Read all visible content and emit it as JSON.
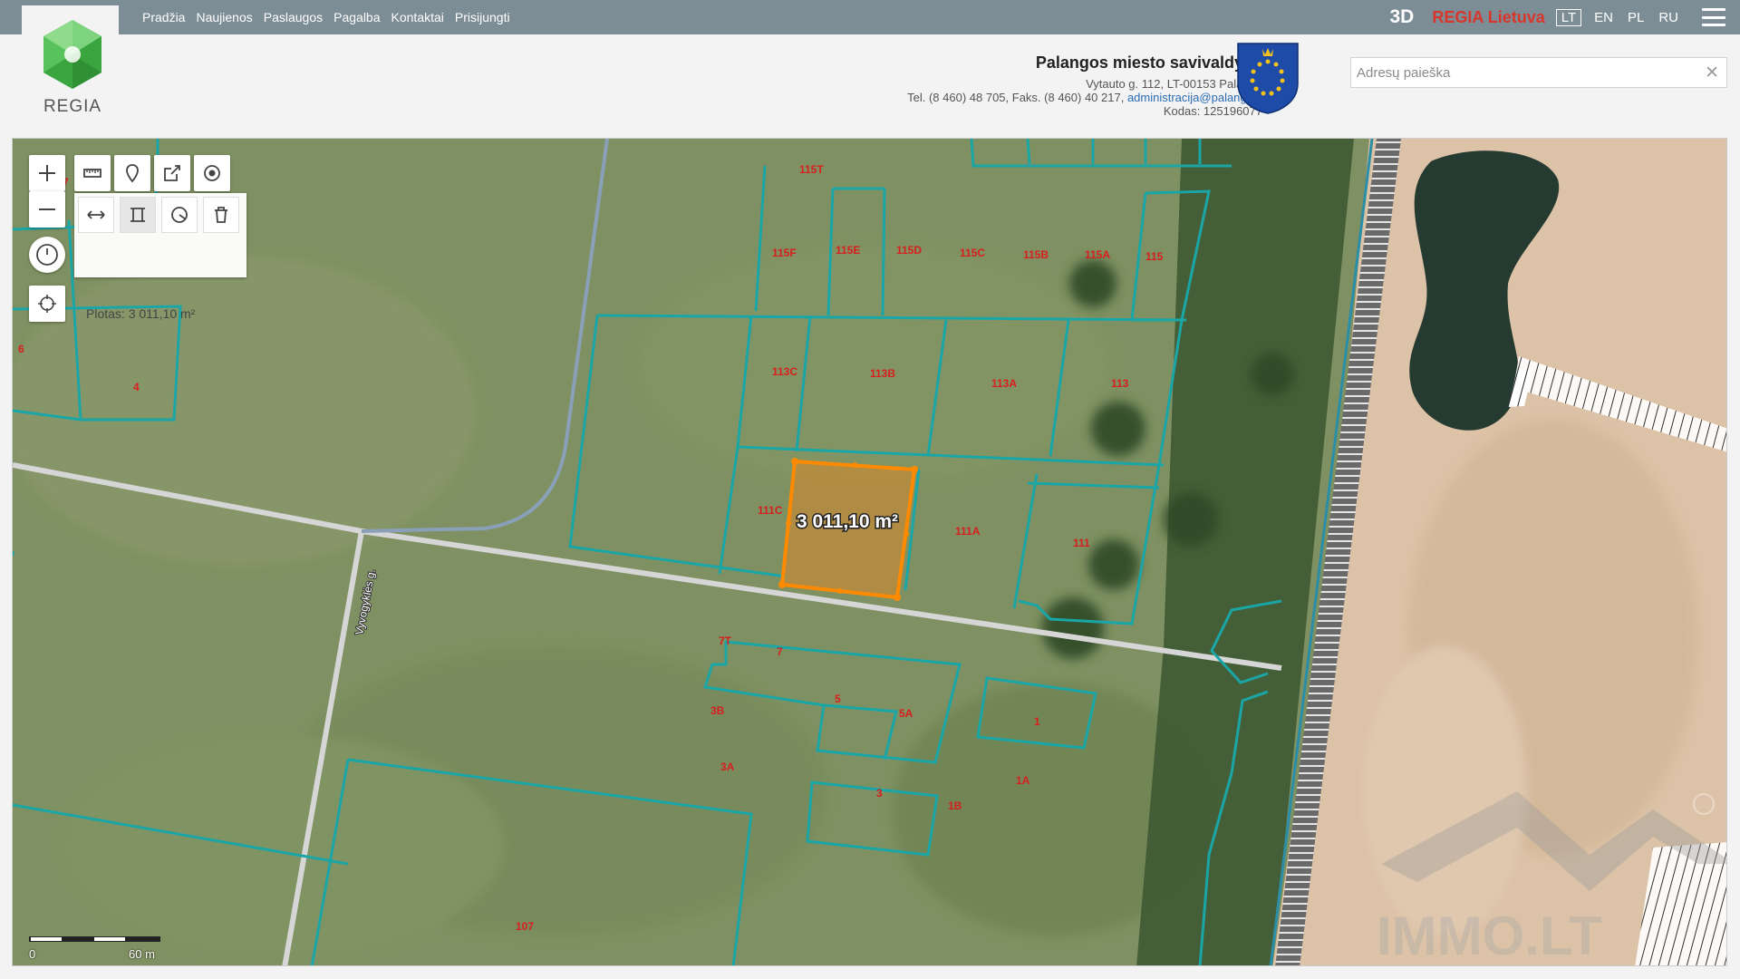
{
  "nav": {
    "items": [
      "Pradžia",
      "Naujienos",
      "Paslaugos",
      "Pagalba",
      "Kontaktai",
      "Prisijungti"
    ]
  },
  "top_right": {
    "btn_3d": "3D",
    "regia_lietuva": "REGIA Lietuva",
    "languages": [
      "LT",
      "EN",
      "PL",
      "RU"
    ],
    "active_language": "LT"
  },
  "logo": {
    "text": "REGIA"
  },
  "municipality": {
    "name": "Palangos miesto savivaldybė",
    "address": "Vytauto g. 112, LT-00153 Palanga",
    "phone_prefix": "Tel. (8 460) 48 705, Faks. (8 460) 40 217, ",
    "email": "administracija@palanga.lt",
    "code": "Kodas: 125196077"
  },
  "search": {
    "placeholder": "Adresų paieška",
    "value": ""
  },
  "map": {
    "area_text": "Plotas: 3 011,10 m²",
    "measure_label": "3 011,10 m²",
    "street_label": "Vyvogyklės g.",
    "scale_left": "0",
    "scale_right": "60 m",
    "watermark": "IMMO.LT",
    "parcel_labels": [
      "115T",
      "115F",
      "115E",
      "115D",
      "115C",
      "115B",
      "115A",
      "115",
      "113C",
      "113B",
      "113A",
      "113",
      "111C",
      "111A",
      "111",
      "7T",
      "7",
      "3B",
      "5",
      "5A",
      "1",
      "3A",
      "1A",
      "3",
      "1B",
      "107",
      "6",
      "4",
      "7"
    ]
  },
  "colors": {
    "parcel_line": "#1aa6a6",
    "parcel_label": "#d81e1e",
    "measure_fill": "#d9872a",
    "measure_stroke": "#ff8a00",
    "header_bar": "#7c8d96"
  }
}
